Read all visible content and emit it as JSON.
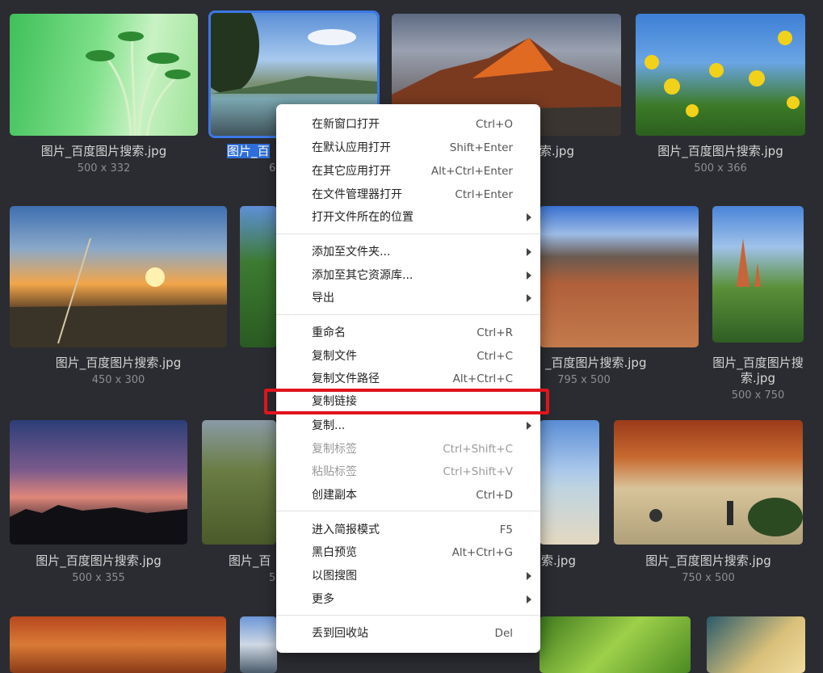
{
  "gallery": [
    {
      "caption": "图片_百度图片搜索.jpg",
      "dims": "500 x 332"
    },
    {
      "caption_pre": "图片_百",
      "caption_post": "",
      "dims": "6"
    },
    {
      "caption": "ᠮ.jpg",
      "dims": ""
    },
    {
      "caption": "图片_百度图片搜索.jpg",
      "dims": "500 x 366"
    },
    {
      "caption": "图片_百度图片搜索.jpg",
      "dims": "450 x 300"
    },
    {
      "caption": "_百度图片搜索.jpg",
      "dims": "795 x 500"
    },
    {
      "caption": "图片_百度图片搜索.jpg",
      "dims": "500 x 750"
    },
    {
      "caption": "图片_百度图片搜索.jpg",
      "dims": "500 x 355"
    },
    {
      "caption": "图片_百",
      "dims": "5"
    },
    {
      "caption": "索.jpg",
      "dims": ""
    },
    {
      "caption": "图片_百度图片搜索.jpg",
      "dims": "750 x 500"
    }
  ],
  "context_menu": {
    "items": [
      {
        "label": "在新窗口打开",
        "shortcut": "Ctrl+O"
      },
      {
        "label": "在默认应用打开",
        "shortcut": "Shift+Enter"
      },
      {
        "label": "在其它应用打开",
        "shortcut": "Alt+Ctrl+Enter"
      },
      {
        "label": "在文件管理器打开",
        "shortcut": "Ctrl+Enter"
      },
      {
        "label": "打开文件所在的位置",
        "shortcut": ""
      },
      {
        "label": "添加至文件夹...",
        "shortcut": ""
      },
      {
        "label": "添加至其它资源库...",
        "shortcut": ""
      },
      {
        "label": "导出",
        "shortcut": ""
      },
      {
        "label": "重命名",
        "shortcut": "Ctrl+R"
      },
      {
        "label": "复制文件",
        "shortcut": "Ctrl+C"
      },
      {
        "label": "复制文件路径",
        "shortcut": "Alt+Ctrl+C"
      },
      {
        "label": "复制链接",
        "shortcut": ""
      },
      {
        "label": "复制...",
        "shortcut": ""
      },
      {
        "label": "复制标签",
        "shortcut": "Ctrl+Shift+C"
      },
      {
        "label": "粘贴标签",
        "shortcut": "Ctrl+Shift+V"
      },
      {
        "label": "创建副本",
        "shortcut": "Ctrl+D"
      },
      {
        "label": "进入简报模式",
        "shortcut": "F5"
      },
      {
        "label": "黑白预览",
        "shortcut": "Alt+Ctrl+G"
      },
      {
        "label": "以图搜图",
        "shortcut": ""
      },
      {
        "label": "更多",
        "shortcut": ""
      },
      {
        "label": "丢到回收站",
        "shortcut": "Del"
      }
    ]
  },
  "colors": {
    "background": "#2b2c31",
    "selection": "#3c78e6",
    "highlight": "#e0141e"
  }
}
